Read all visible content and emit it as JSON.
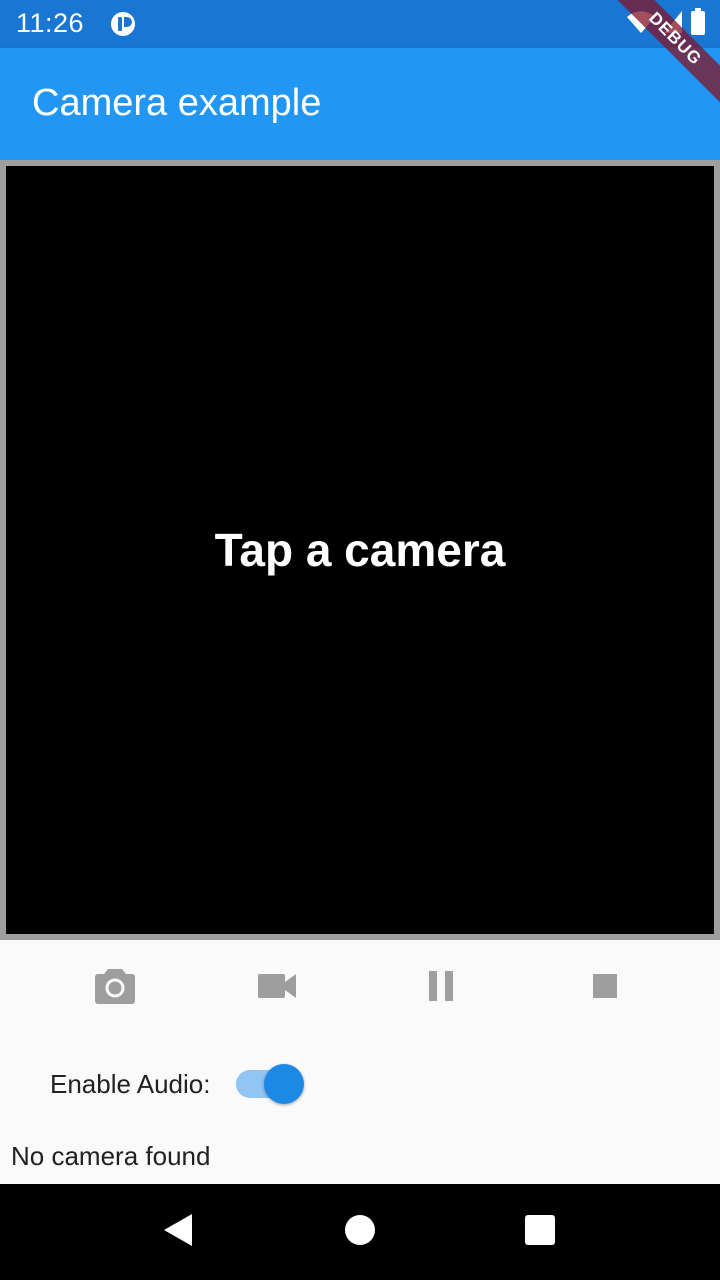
{
  "status_bar": {
    "time": "11:26",
    "icons": [
      "app-notification-icon",
      "wifi-icon",
      "signal-icon",
      "battery-icon"
    ]
  },
  "debug_banner": {
    "label": "DEBUG",
    "color": "#8c1a2e"
  },
  "app_bar": {
    "title": "Camera example",
    "color": "#2196f3"
  },
  "preview": {
    "message": "Tap a camera"
  },
  "controls": {
    "buttons": [
      {
        "icon": "camera-icon",
        "label": ""
      },
      {
        "icon": "videocam-icon",
        "label": ""
      },
      {
        "icon": "pause-icon",
        "label": ""
      },
      {
        "icon": "stop-icon",
        "label": ""
      }
    ],
    "icon_color": "#9e9e9e"
  },
  "audio": {
    "label": "Enable Audio:",
    "enabled": true,
    "accent": "#1e88e5"
  },
  "camera_status": {
    "text": "No camera found"
  },
  "nav_bar": {
    "buttons": [
      "back-icon",
      "home-icon",
      "recents-icon"
    ]
  }
}
